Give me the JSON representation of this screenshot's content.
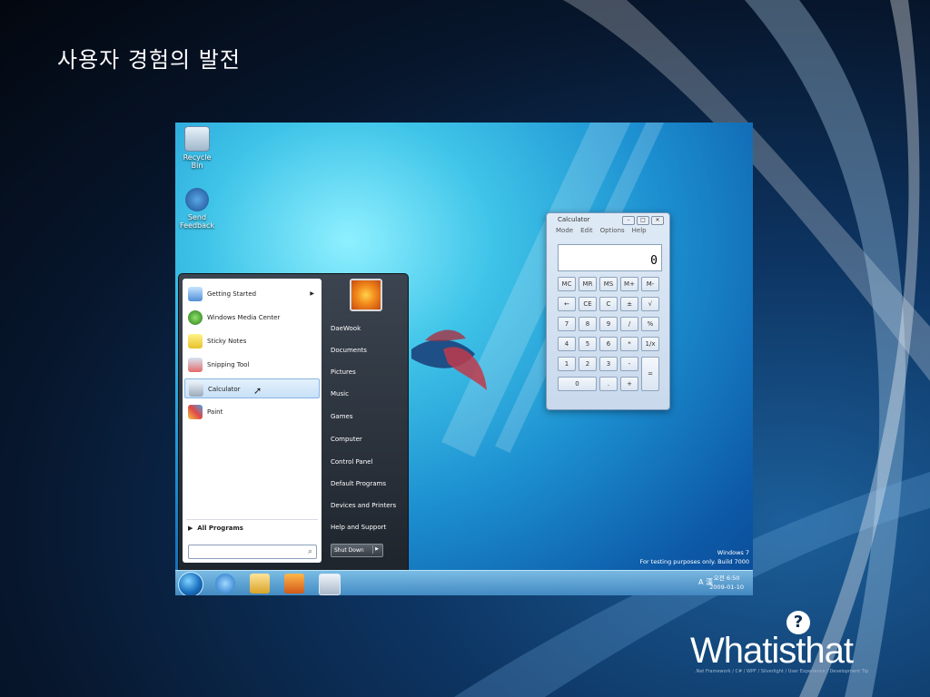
{
  "slide": {
    "title": "사용자 경험의 발전"
  },
  "desktop": {
    "icons": [
      {
        "label": "Recycle Bin",
        "icon": "recycle-bin-icon"
      },
      {
        "label": "Send Feedback",
        "icon": "feedback-icon"
      }
    ],
    "watermark": {
      "line1": "Windows 7",
      "line2": "For testing purposes only. Build 7000"
    }
  },
  "calculator": {
    "title": "Calculator",
    "menu": [
      "Mode",
      "Edit",
      "Options",
      "Help"
    ],
    "display": "0",
    "keys": [
      "MC",
      "MR",
      "MS",
      "M+",
      "M-",
      "←",
      "CE",
      "C",
      "±",
      "√",
      "7",
      "8",
      "9",
      "/",
      "%",
      "4",
      "5",
      "6",
      "*",
      "1/x",
      "1",
      "2",
      "3",
      "-",
      "=",
      "0",
      ".",
      "+"
    ]
  },
  "start_menu": {
    "programs": [
      {
        "label": "Getting Started",
        "icon": "getting-started-icon",
        "has_submenu": true
      },
      {
        "label": "Windows Media Center",
        "icon": "media-center-icon"
      },
      {
        "label": "Sticky Notes",
        "icon": "sticky-notes-icon"
      },
      {
        "label": "Snipping Tool",
        "icon": "snipping-tool-icon"
      },
      {
        "label": "Calculator",
        "icon": "calculator-icon",
        "selected": true
      },
      {
        "label": "Paint",
        "icon": "paint-icon"
      }
    ],
    "all_programs": "All Programs",
    "search_placeholder": "",
    "right_items": [
      "DaeWook",
      "Documents",
      "Pictures",
      "Music",
      "Games",
      "Computer",
      "Control Panel",
      "Default Programs",
      "Devices and Printers",
      "Help and Support"
    ],
    "shutdown": "Shut Down"
  },
  "taskbar": {
    "pinned": [
      "internet-explorer-icon",
      "windows-explorer-icon",
      "media-player-icon",
      "calculator-icon"
    ],
    "tray": "A 漢",
    "clock_time": "오전 6:50",
    "clock_date": "2009-01-10"
  },
  "brand": {
    "name": "Whatisthat",
    "tagline": ".Net Framework / C# / WPF / Silverlight / User Experience / Development Tip"
  },
  "colors": {
    "accent": "#3fc4e8",
    "start_bg": "#2b323b"
  }
}
